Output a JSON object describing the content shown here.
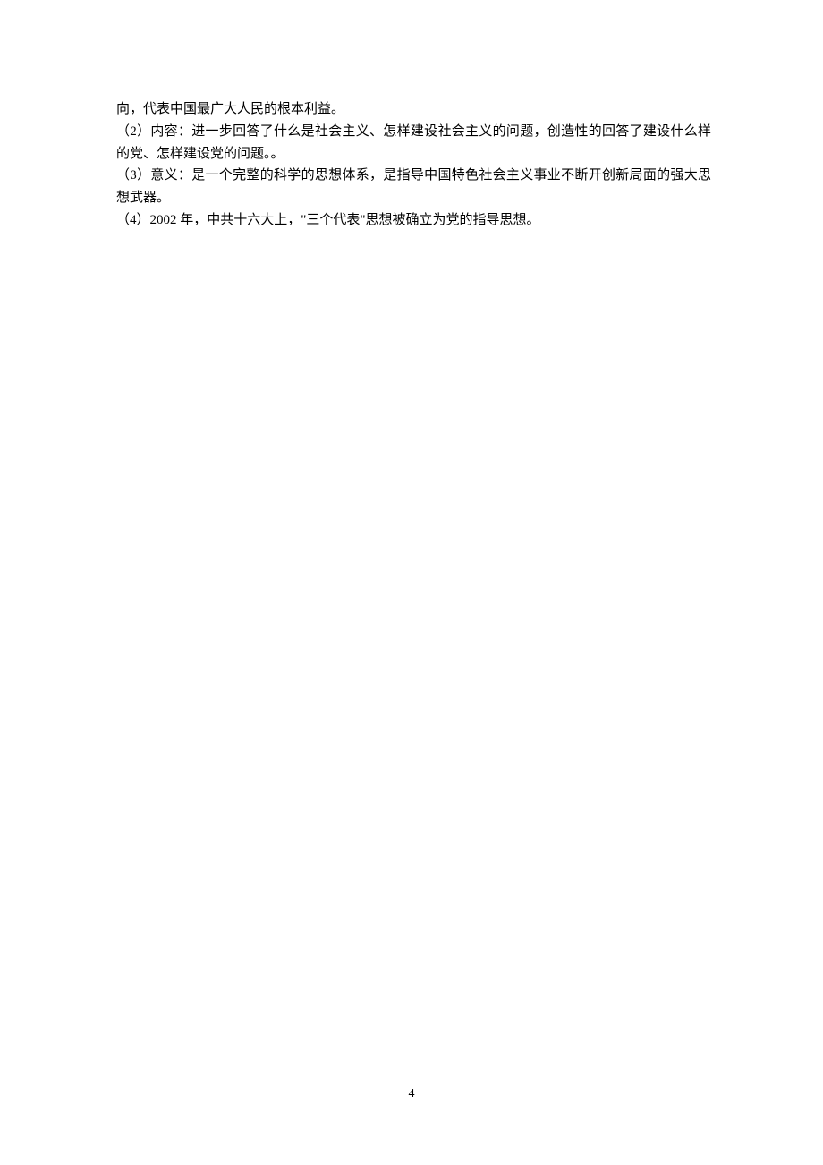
{
  "content": {
    "line1": "向，代表中国最广大人民的根本利益。",
    "line2": "（2）内容：进一步回答了什么是社会主义、怎样建设社会主义的问题，创造性的回答了建设什么样的党、怎样建设党的问题。。",
    "line3": "（3）意义：是一个完整的科学的思想体系，是指导中国特色社会主义事业不断开创新局面的强大思想武器。",
    "line4": "（4）2002 年，中共十六大上，\"三个代表\"思想被确立为党的指导思想。"
  },
  "page_number": "4"
}
